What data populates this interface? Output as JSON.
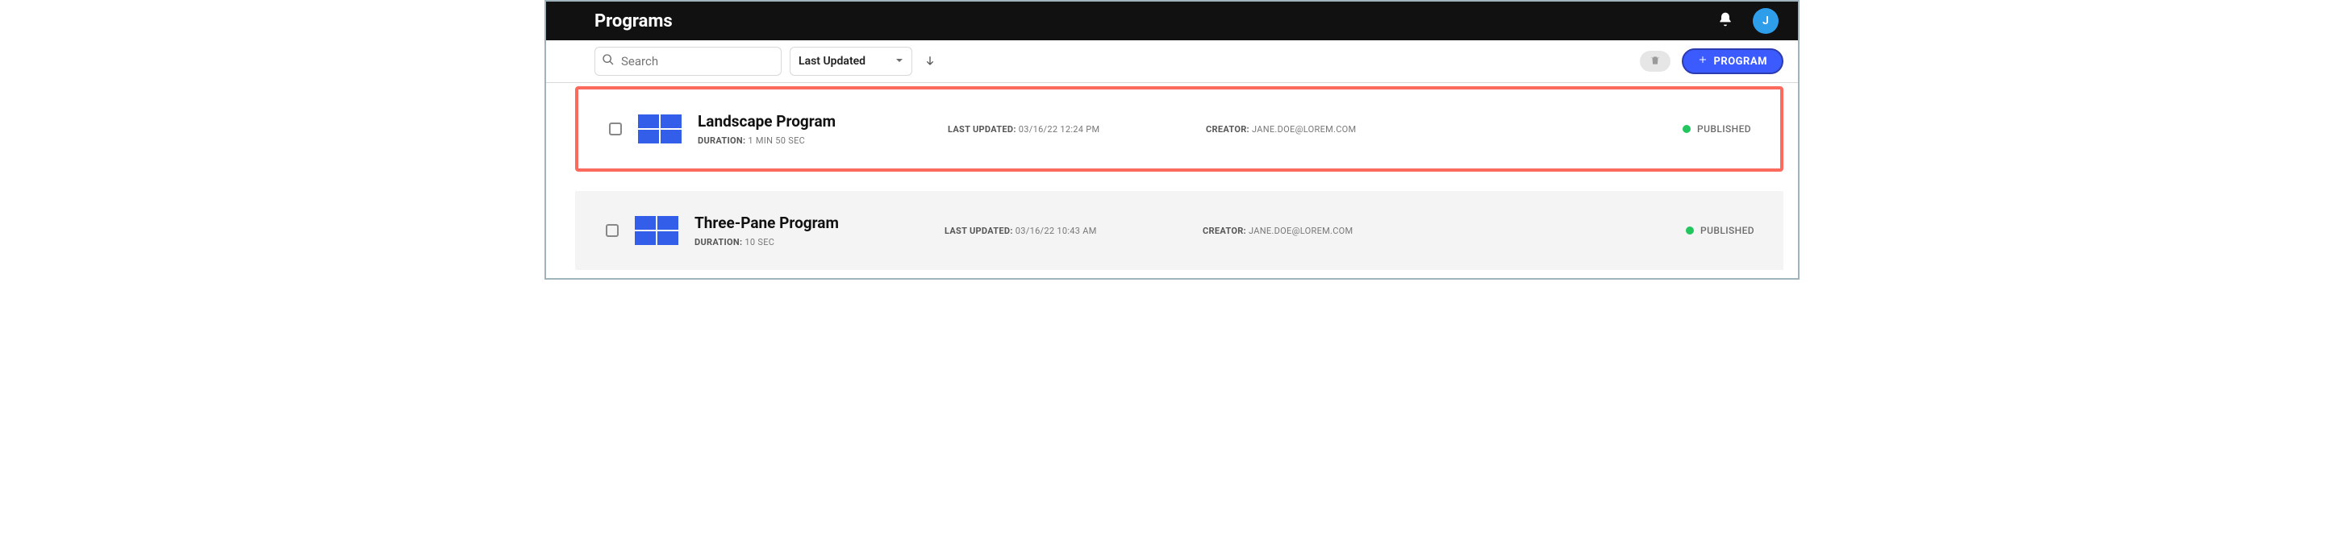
{
  "header": {
    "title": "Programs",
    "avatar_initial": "J"
  },
  "toolbar": {
    "search_placeholder": "Search",
    "sort_label": "Last Updated",
    "new_button_label": "PROGRAM"
  },
  "labels": {
    "duration": "DURATION:",
    "last_updated": "LAST UPDATED:",
    "creator": "CREATOR:"
  },
  "programs": [
    {
      "name": "Landscape Program",
      "duration": "1 MIN 50 SEC",
      "last_updated": "03/16/22 12:24 PM",
      "creator": "JANE.DOE@LOREM.COM",
      "status": "PUBLISHED",
      "highlighted": true
    },
    {
      "name": "Three-Pane Program",
      "duration": "10 SEC",
      "last_updated": "03/16/22 10:43 AM",
      "creator": "JANE.DOE@LOREM.COM",
      "status": "PUBLISHED",
      "highlighted": false
    }
  ]
}
